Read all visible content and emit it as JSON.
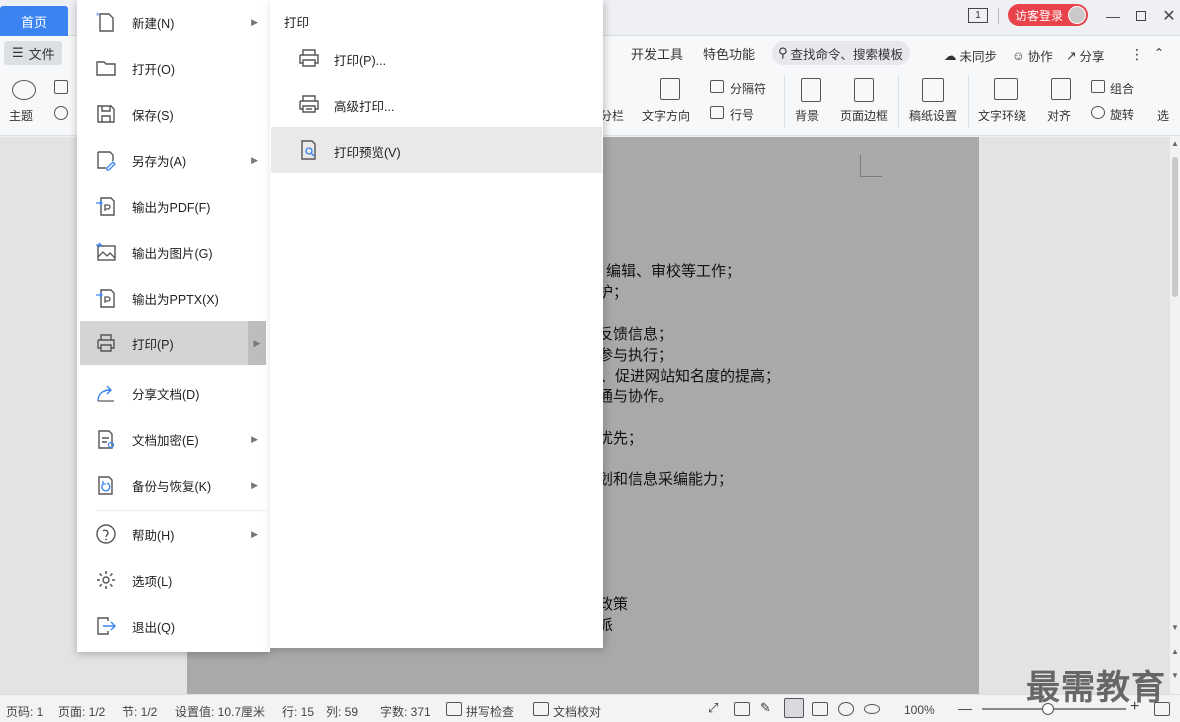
{
  "titlebar": {
    "home_tab": "首页",
    "page_indicator": "1",
    "login_button": "访客登录"
  },
  "ribbon": {
    "file_menu": "文件",
    "tabs": [
      "开发工具",
      "特色功能"
    ],
    "search_placeholder": "查找命令、搜索模板",
    "unsync": "未同步",
    "collab": "协作",
    "share": "分享",
    "tools": {
      "theme": "主题",
      "columns_partial": "分栏",
      "text_direction": "文字方向",
      "separator": "分隔符",
      "line_number": "行号",
      "background": "背景",
      "page_border": "页面边框",
      "draft_settings": "稿纸设置",
      "text_wrap": "文字环绕",
      "align": "对齐",
      "group": "组合",
      "rotate": "旋转",
      "select_partial": "选"
    }
  },
  "document": {
    "lines": [
      "编辑、审校等工作；",
      "护；",
      "反馈信息；",
      "参与执行；",
      "、促进网站知名度的提高；",
      "通与协作。",
      "优先；",
      "划和信息采编能力；",
      "政策",
      "派"
    ]
  },
  "file_menu": {
    "items": [
      {
        "label": "新建(N)",
        "icon": "new-doc-icon",
        "arrow": true
      },
      {
        "label": "打开(O)",
        "icon": "folder-open-icon",
        "arrow": false
      },
      {
        "label": "保存(S)",
        "icon": "save-icon",
        "arrow": false
      },
      {
        "label": "另存为(A)",
        "icon": "save-as-icon",
        "arrow": true
      },
      {
        "label": "输出为PDF(F)",
        "icon": "export-pdf-icon",
        "arrow": false
      },
      {
        "label": "输出为图片(G)",
        "icon": "export-image-icon",
        "arrow": false
      },
      {
        "label": "输出为PPTX(X)",
        "icon": "export-pptx-icon",
        "arrow": false
      },
      {
        "label": "打印(P)",
        "icon": "printer-icon",
        "arrow": true,
        "active": true
      },
      {
        "label": "分享文档(D)",
        "icon": "share-icon",
        "arrow": false
      },
      {
        "label": "文档加密(E)",
        "icon": "encrypt-icon",
        "arrow": true
      },
      {
        "label": "备份与恢复(K)",
        "icon": "backup-icon",
        "arrow": true
      },
      {
        "label": "帮助(H)",
        "icon": "help-icon",
        "arrow": true
      },
      {
        "label": "选项(L)",
        "icon": "gear-icon",
        "arrow": false
      },
      {
        "label": "退出(Q)",
        "icon": "exit-icon",
        "arrow": false
      }
    ]
  },
  "print_submenu": {
    "title": "打印",
    "items": [
      {
        "label": "打印(P)...",
        "icon": "printer-icon"
      },
      {
        "label": "高级打印...",
        "icon": "advanced-print-icon"
      },
      {
        "label": "打印预览(V)",
        "icon": "print-preview-icon",
        "hover": true
      }
    ]
  },
  "statusbar": {
    "page_code": "页码: 1",
    "page": "页面: 1/2",
    "section": "节: 1/2",
    "setting": "设置值: 10.7厘米",
    "row": "行: 15",
    "col": "列: 59",
    "word_count": "字数: 371",
    "spell_check": "拼写检查",
    "doc_proofread": "文档校对",
    "zoom": "100%"
  },
  "watermark": "最需教育"
}
